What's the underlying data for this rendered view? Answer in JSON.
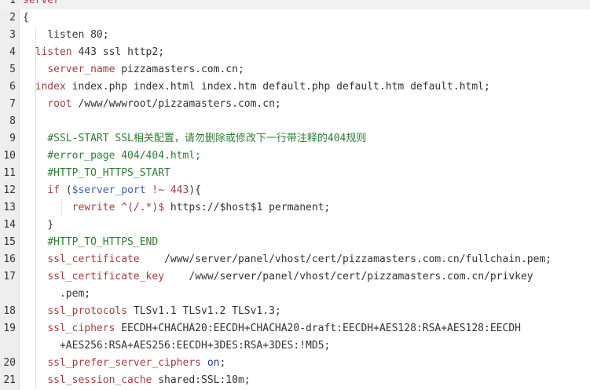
{
  "colors": {
    "gutter_bg": "#eeeeee",
    "keyword": "#a03f3f",
    "keyword_blue": "#1f3d9a",
    "variable": "#3d5fb0",
    "comment": "#2e7d32",
    "text": "#333333"
  },
  "editor": {
    "lines": [
      {
        "n": "1",
        "tokens": [
          {
            "c": "server",
            "k": "kw"
          }
        ]
      },
      {
        "n": "2",
        "tokens": [
          {
            "c": "{",
            "k": "t"
          }
        ]
      },
      {
        "n": "3",
        "tokens": [
          {
            "c": "    listen 80;",
            "k": "t"
          }
        ]
      },
      {
        "n": "4",
        "tokens": [
          {
            "c": "  ",
            "k": "t"
          },
          {
            "c": "listen",
            "k": "kw"
          },
          {
            "c": " 443 ssl http2;",
            "k": "t"
          }
        ]
      },
      {
        "n": "5",
        "tokens": [
          {
            "c": "    ",
            "k": "t"
          },
          {
            "c": "server_name",
            "k": "kw"
          },
          {
            "c": " pizzamasters.com.cn;",
            "k": "t"
          }
        ]
      },
      {
        "n": "6",
        "tokens": [
          {
            "c": "  ",
            "k": "t"
          },
          {
            "c": "index",
            "k": "kw"
          },
          {
            "c": " index.php index.html index.htm default.php default.htm default.html;",
            "k": "t"
          }
        ]
      },
      {
        "n": "7",
        "tokens": [
          {
            "c": "    ",
            "k": "t"
          },
          {
            "c": "root",
            "k": "kw"
          },
          {
            "c": " /www/wwwroot/pizzamasters.com.cn;",
            "k": "t"
          }
        ]
      },
      {
        "n": "8",
        "tokens": [
          {
            "c": "",
            "k": "t"
          }
        ]
      },
      {
        "n": "9",
        "tokens": [
          {
            "c": "    ",
            "k": "t"
          },
          {
            "c": "#SSL-START SSL相关配置，请勿删除或修改下一行带注释的404规则",
            "k": "cm"
          }
        ]
      },
      {
        "n": "10",
        "tokens": [
          {
            "c": "    ",
            "k": "t"
          },
          {
            "c": "#error_page 404/404.html;",
            "k": "cm"
          }
        ]
      },
      {
        "n": "11",
        "tokens": [
          {
            "c": "    ",
            "k": "t"
          },
          {
            "c": "#HTTP_TO_HTTPS_START",
            "k": "cm"
          }
        ]
      },
      {
        "n": "12",
        "tokens": [
          {
            "c": "    ",
            "k": "t"
          },
          {
            "c": "if",
            "k": "kw"
          },
          {
            "c": " (",
            "k": "t"
          },
          {
            "c": "$server_port",
            "k": "var"
          },
          {
            "c": " ",
            "k": "t"
          },
          {
            "c": "!~",
            "k": "kw"
          },
          {
            "c": " ",
            "k": "t"
          },
          {
            "c": "443",
            "k": "str"
          },
          {
            "c": "){",
            "k": "t"
          }
        ]
      },
      {
        "n": "13",
        "tokens": [
          {
            "c": "        ",
            "k": "t"
          },
          {
            "c": "rewrite",
            "k": "kw"
          },
          {
            "c": " ",
            "k": "t"
          },
          {
            "c": "^(/.*)$",
            "k": "str"
          },
          {
            "c": " https://$host$1 permanent;",
            "k": "t"
          }
        ]
      },
      {
        "n": "14",
        "tokens": [
          {
            "c": "    }",
            "k": "t"
          }
        ]
      },
      {
        "n": "15",
        "tokens": [
          {
            "c": "    ",
            "k": "t"
          },
          {
            "c": "#HTTP_TO_HTTPS_END",
            "k": "cm"
          }
        ]
      },
      {
        "n": "16",
        "tokens": [
          {
            "c": "    ",
            "k": "t"
          },
          {
            "c": "ssl_certificate",
            "k": "kw"
          },
          {
            "c": "    /www/server/panel/vhost/cert/pizzamasters.com.cn/fullchain.pem;",
            "k": "t"
          }
        ]
      },
      {
        "n": "17",
        "tokens": [
          {
            "c": "    ",
            "k": "t"
          },
          {
            "c": "ssl_certificate_key",
            "k": "kw"
          },
          {
            "c": "    /www/server/panel/vhost/cert/pizzamasters.com.cn/privkey\n      .pem;",
            "k": "t"
          }
        ]
      },
      {
        "n": "18",
        "tokens": [
          {
            "c": "    ",
            "k": "t"
          },
          {
            "c": "ssl_protocols",
            "k": "kw"
          },
          {
            "c": " TLSv1.1 TLSv1.2 TLSv1.3;",
            "k": "t"
          }
        ]
      },
      {
        "n": "19",
        "tokens": [
          {
            "c": "    ",
            "k": "t"
          },
          {
            "c": "ssl_ciphers",
            "k": "kw"
          },
          {
            "c": " EECDH+CHACHA20:EECDH+CHACHA20-draft:EECDH+AES128:RSA+AES128:EECDH\n      +AES256:RSA+AES256:EECDH+3DES:RSA+3DES:!MD5;",
            "k": "t"
          }
        ]
      },
      {
        "n": "20",
        "tokens": [
          {
            "c": "    ",
            "k": "t"
          },
          {
            "c": "ssl_prefer_server_ciphers",
            "k": "kw"
          },
          {
            "c": " ",
            "k": "t"
          },
          {
            "c": "on",
            "k": "kwb"
          },
          {
            "c": ";",
            "k": "t"
          }
        ]
      },
      {
        "n": "21",
        "tokens": [
          {
            "c": "    ",
            "k": "t"
          },
          {
            "c": "ssl_session_cache",
            "k": "kw"
          },
          {
            "c": " shared:SSL:10m;",
            "k": "t"
          }
        ]
      }
    ]
  }
}
